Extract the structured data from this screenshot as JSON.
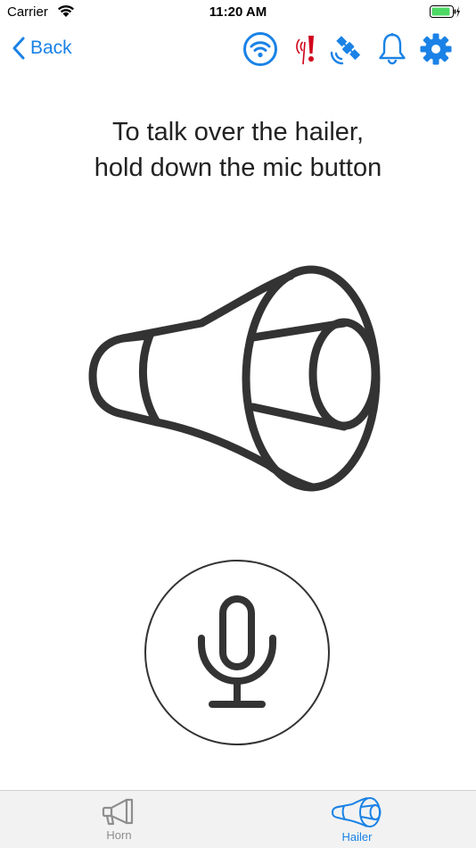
{
  "status_bar": {
    "carrier": "Carrier",
    "time": "11:20 AM"
  },
  "nav": {
    "back_label": "Back",
    "icons": [
      "wifi-icon",
      "signal-alert-icon",
      "satellite-icon",
      "bell-icon",
      "gear-icon"
    ]
  },
  "main": {
    "instruction_line1": "To talk over the hailer,",
    "instruction_line2": "hold down the mic button"
  },
  "tabs": [
    {
      "label": "Horn",
      "selected": false
    },
    {
      "label": "Hailer",
      "selected": true
    }
  ],
  "colors": {
    "accent": "#1a82e6",
    "alert": "#d0021b",
    "battery": "#4cd964",
    "icon_dark": "#333333",
    "tab_inactive": "#8e8e8e"
  }
}
